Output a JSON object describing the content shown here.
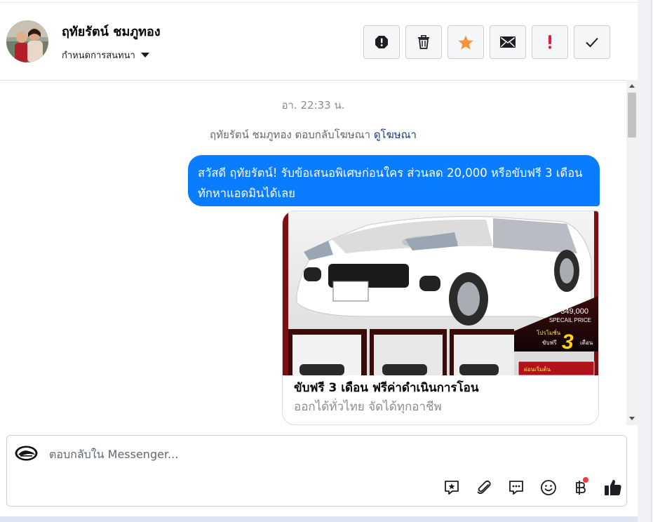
{
  "header": {
    "contact_name": "ฤทัยรัตน์ ชมภูทอง",
    "assign_label": "กำหนดการสนทนา",
    "actions": [
      {
        "name": "spam-button",
        "icon": "exclamation-octagon-icon"
      },
      {
        "name": "delete-button",
        "icon": "trash-icon"
      },
      {
        "name": "star-button",
        "icon": "star-icon",
        "color": "#f7923b"
      },
      {
        "name": "unread-button",
        "icon": "envelope-icon"
      },
      {
        "name": "important-button",
        "icon": "exclamation-icon",
        "color": "#e41e3f"
      },
      {
        "name": "done-button",
        "icon": "checkmark-icon"
      }
    ]
  },
  "conversation": {
    "timestamp": "อา. 22:33 น.",
    "system_note": "ฤทัยรัตน์ ชมภูทอง ตอบกลับโฆษณา",
    "system_link": "ดูโฆษณา",
    "message": "สวัสดี ฤทัยรัตน์! รับข้อเสนอพิเศษก่อนใคร ส่วนลด 20,000 หรือขับฟรี 3 เดือน  ทักหาแอดมินได้เลย",
    "ad_card": {
      "image_alt": "white-toyota-avanza-ad-image",
      "price_text": "349,000",
      "price_caption": "SPECAIL PRICE",
      "promo_text": "โปรโมชั่น",
      "promo_free": "ขับฟรี",
      "promo_number": "3",
      "promo_unit": "เดือน",
      "installment_text": "ผ่อนเริ่มต้น",
      "title": "ขับฟรี 3 เดือน ฟรีค่าดำเนินการโอน",
      "subtitle": "ออกได้ทั่วไทย จัดได้ทุกอาชีพ"
    }
  },
  "composer": {
    "placeholder": "ตอบกลับใน Messenger...",
    "tools": [
      "saved-reply-icon",
      "paperclip-icon",
      "chat-bubble-icon",
      "emoji-icon",
      "baht-icon",
      "thumbs-up-icon"
    ],
    "notification_color": "#fa383e"
  },
  "colors": {
    "bubble": "#0a7cff",
    "accent_link": "#1d3b82",
    "like_icon": "#1c1e21"
  }
}
